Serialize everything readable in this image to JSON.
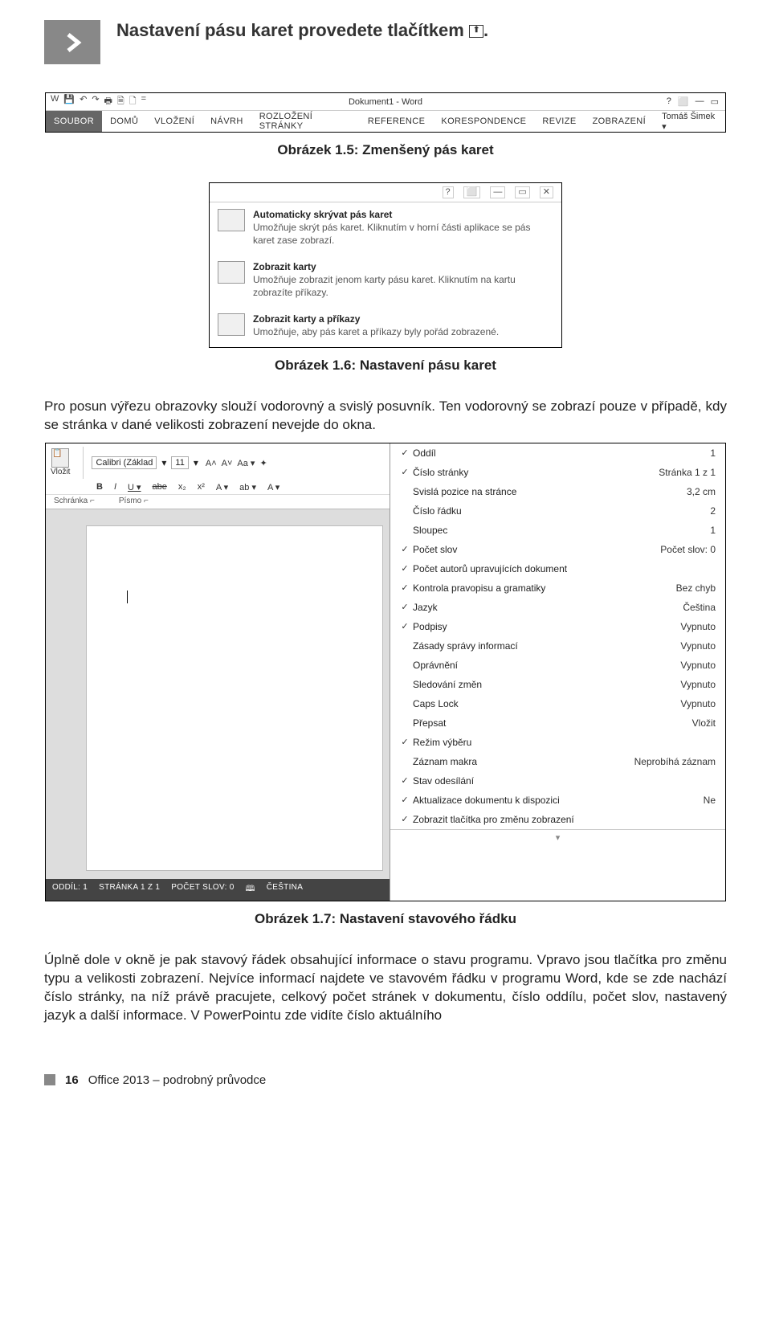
{
  "tip": {
    "text": "Nastavení pásu karet provedete tlačítkem"
  },
  "fig5": {
    "qat": [
      "W",
      "💾",
      "↶",
      "↷",
      "🖶",
      "🗎",
      "🗋",
      "="
    ],
    "title": "Dokument1 - Word",
    "winctrl": [
      "?",
      "⬜",
      "—",
      "▭"
    ],
    "tabs": [
      "SOUBOR",
      "DOMŮ",
      "VLOŽENÍ",
      "NÁVRH",
      "ROZLOŽENÍ STRÁNKY",
      "REFERENCE",
      "KORESPONDENCE",
      "REVIZE",
      "ZOBRAZENÍ"
    ],
    "user": "Tomáš Šimek ▾"
  },
  "caption5": "Obrázek 1.5: Zmenšený pás karet",
  "fig6": {
    "controls": [
      "?",
      "⬜",
      "—",
      "▭",
      "✕"
    ],
    "options": [
      {
        "title": "Automaticky skrývat pás karet",
        "desc": "Umožňuje skrýt pás karet. Kliknutím v horní části aplikace se pás karet zase zobrazí."
      },
      {
        "title": "Zobrazit karty",
        "desc": "Umožňuje zobrazit jenom karty pásu karet. Kliknutím na kartu zobrazíte příkazy."
      },
      {
        "title": "Zobrazit karty a příkazy",
        "desc": "Umožňuje, aby pás karet a příkazy byly pořád zobrazené."
      }
    ]
  },
  "caption6": "Obrázek 1.6: Nastavení pásu karet",
  "para1": "Pro posun výřezu obrazovky slouží vodorovný a svislý posuvník. Ten vodorovný se zobrazí pouze v případě, kdy se stránka v dané velikosti zobrazení nevejde do okna.",
  "fig7": {
    "clipboard_label": "Vložit",
    "font_name": "Calibri (Základ",
    "font_size": "11",
    "row1_btns": [
      "A˄",
      "A˅",
      "Aa ▾",
      "✦"
    ],
    "row2_btns": [
      "B",
      "I",
      "U ▾",
      "abe",
      "x₂",
      "x²",
      "A ▾",
      "ab ▾",
      "A ▾"
    ],
    "groups": [
      "Schránka  ⌐",
      "Písmo                                  ⌐"
    ],
    "status": [
      "ODDÍL: 1",
      "STRÁNKA 1 Z 1",
      "POČET SLOV: 0",
      "🕮",
      "ČEŠTINA"
    ],
    "menu": [
      {
        "chk": "✓",
        "label": "Oddíl",
        "val": "1"
      },
      {
        "chk": "✓",
        "label": "Číslo stránky",
        "val": "Stránka 1 z 1"
      },
      {
        "chk": "",
        "label": "Svislá pozice na stránce",
        "val": "3,2 cm"
      },
      {
        "chk": "",
        "label": "Číslo řádku",
        "val": "2"
      },
      {
        "chk": "",
        "label": "Sloupec",
        "val": "1"
      },
      {
        "chk": "✓",
        "label": "Počet slov",
        "val": "Počet slov: 0"
      },
      {
        "chk": "✓",
        "label": "Počet autorů upravujících dokument",
        "val": ""
      },
      {
        "chk": "✓",
        "label": "Kontrola pravopisu a gramatiky",
        "val": "Bez chyb"
      },
      {
        "chk": "✓",
        "label": "Jazyk",
        "val": "Čeština"
      },
      {
        "chk": "✓",
        "label": "Podpisy",
        "val": "Vypnuto"
      },
      {
        "chk": "",
        "label": "Zásady správy informací",
        "val": "Vypnuto"
      },
      {
        "chk": "",
        "label": "Oprávnění",
        "val": "Vypnuto"
      },
      {
        "chk": "",
        "label": "Sledování změn",
        "val": "Vypnuto"
      },
      {
        "chk": "",
        "label": "Caps Lock",
        "val": "Vypnuto"
      },
      {
        "chk": "",
        "label": "Přepsat",
        "val": "Vložit"
      },
      {
        "chk": "✓",
        "label": "Režim výběru",
        "val": ""
      },
      {
        "chk": "",
        "label": "Záznam makra",
        "val": "Neprobíhá záznam"
      },
      {
        "chk": "✓",
        "label": "Stav odesílání",
        "val": ""
      },
      {
        "chk": "✓",
        "label": "Aktualizace dokumentu k dispozici",
        "val": "Ne"
      },
      {
        "chk": "✓",
        "label": "Zobrazit tlačítka pro změnu zobrazení",
        "val": ""
      }
    ],
    "menu_foot": "▾"
  },
  "caption7": "Obrázek 1.7: Nastavení stavového řádku",
  "para2": "Úplně dole v okně je pak stavový řádek obsahující informace o stavu programu. Vpravo jsou tlačítka pro změnu typu a velikosti zobrazení. Nejvíce informací najdete ve stavovém řádku v programu Word, kde se zde nachází číslo stránky, na níž právě pracujete, celkový počet stránek v dokumentu, číslo oddílu, počet slov, nastavený jazyk a další informace. V PowerPointu zde vidíte číslo aktuálního",
  "footer": {
    "page": "16",
    "title": "Office 2013 – podrobný průvodce"
  }
}
